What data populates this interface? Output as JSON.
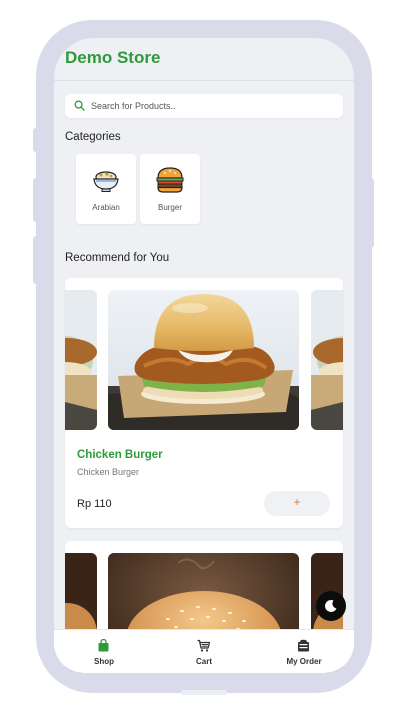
{
  "app": {
    "title": "Demo Store"
  },
  "search": {
    "placeholder": "Search for Products.."
  },
  "categories": {
    "title": "Categories",
    "items": [
      {
        "label": "Arabian",
        "icon": "arabian-bowl-icon"
      },
      {
        "label": "Burger",
        "icon": "burger-icon"
      }
    ]
  },
  "recommend": {
    "title": "Recommend for You",
    "products": [
      {
        "name": "Chicken Burger",
        "description": "Chicken Burger",
        "price": "Rp 110",
        "add_label": "+"
      }
    ]
  },
  "bottom_nav": {
    "items": [
      {
        "label": "Shop",
        "icon": "shop-bag-icon",
        "active": true
      },
      {
        "label": "Cart",
        "icon": "cart-icon",
        "active": false
      },
      {
        "label": "My Order",
        "icon": "order-icon",
        "active": false
      }
    ]
  },
  "colors": {
    "accent": "#2e9b3a",
    "background": "#eff0f4",
    "frame": "#d9dbea",
    "add_icon": "#e07a2c"
  }
}
